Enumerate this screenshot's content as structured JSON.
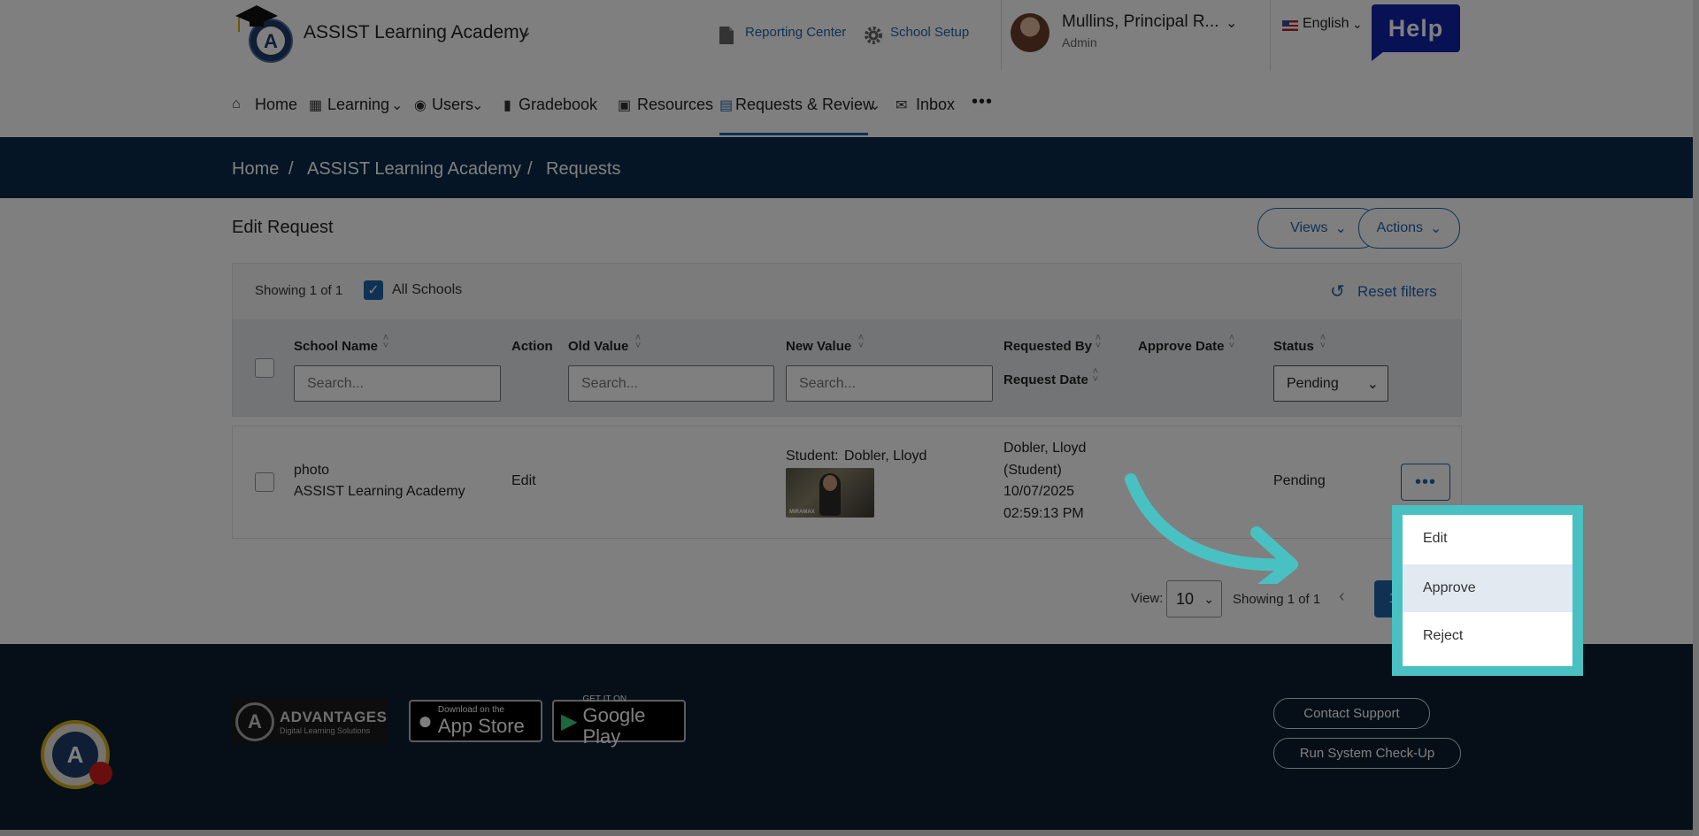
{
  "header": {
    "school_name": "ASSIST Learning Academy",
    "reporting_center": "Reporting Center",
    "school_setup": "School Setup",
    "user_name": "Mullins, Principal R...",
    "user_role": "Admin",
    "language": "English",
    "help": "Help"
  },
  "nav": {
    "items": [
      {
        "label": "Home",
        "icon": "home-icon"
      },
      {
        "label": "Learning",
        "icon": "grid-icon"
      },
      {
        "label": "Users",
        "icon": "user-icon"
      },
      {
        "label": "Gradebook",
        "icon": "book-icon"
      },
      {
        "label": "Resources",
        "icon": "monitor-icon"
      },
      {
        "label": "Requests & Review",
        "icon": "clipboard-icon"
      },
      {
        "label": "Inbox",
        "icon": "mail-icon"
      }
    ],
    "more": "•••",
    "active_index": 5
  },
  "breadcrumb": [
    "Home",
    "ASSIST Learning Academy",
    "Requests"
  ],
  "breadcrumb_separator": "/",
  "page": {
    "title": "Edit Request",
    "views_label": "Views",
    "actions_label": "Actions"
  },
  "filters": {
    "showing": "Showing 1 of 1",
    "all_schools": "All Schools",
    "reset": "Reset filters"
  },
  "table": {
    "headers": {
      "school_name": "School Name",
      "action": "Action",
      "old_value": "Old Value",
      "new_value": "New Value",
      "requested_by": "Requested By",
      "request_date": "Request Date",
      "approve_date": "Approve Date",
      "status": "Status"
    },
    "search_placeholder": "Search...",
    "status_filter": "Pending",
    "rows": [
      {
        "type": "photo",
        "school": "ASSIST Learning Academy",
        "action": "Edit",
        "new_value_prefix": "Student:",
        "new_value_link": "Dobler, Lloyd",
        "requested_by_name": "Dobler, Lloyd",
        "requested_by_role": "(Student)",
        "request_date": "10/07/2025",
        "request_time": "02:59:13 PM",
        "status": "Pending"
      }
    ]
  },
  "row_menu": {
    "button": "•••",
    "items": [
      "Edit",
      "Approve",
      "Reject"
    ],
    "highlighted": "Approve"
  },
  "pagination": {
    "view_label": "View:",
    "page_size": "10",
    "showing": "Showing 1 of 1",
    "current_page": "1"
  },
  "footer": {
    "brand": "ADVANTAGES",
    "brand_sub": "Digital Learning Solutions",
    "app_store_small": "Download on the",
    "app_store_big": "App Store",
    "google_small": "GET IT ON",
    "google_big": "Google Play",
    "contact_support": "Contact Support",
    "system_check": "Run System Check-Up"
  },
  "colors": {
    "primary": "#1f64a8",
    "navy_band": "#0b2a4a",
    "footer": "#0c1e30",
    "help": "#0f23a8",
    "highlight_frame": "#49c1c2"
  }
}
